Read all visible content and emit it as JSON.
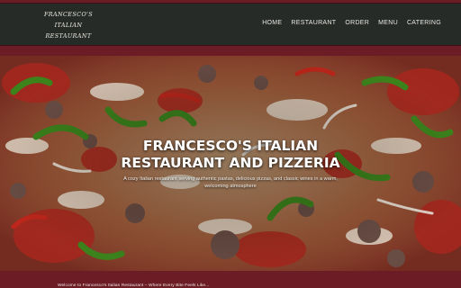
{
  "logo": {
    "line1": "FRANCESCO'S",
    "line2": "ITALIAN",
    "line3": "RESTAURANT"
  },
  "nav": {
    "items": [
      "HOME",
      "RESTAURANT",
      "ORDER",
      "MENU",
      "CATERING"
    ]
  },
  "hero": {
    "title_line1": "FRANCESCO'S ITALIAN",
    "title_line2": "RESTAURANT AND PIZZERIA",
    "subtitle": "A cozy Italian restaurant serving authentic pastas, delicious pizzas, and classic wines in a warm, welcoming atmosphere"
  },
  "footer": {
    "welcome_text": "Welcome to Francesco's Italian Restaurant – Where Every Bite Feels Like..."
  },
  "colors": {
    "page_background": "#6b1c24",
    "header_background": "#262b28",
    "text_light": "#ffffff"
  }
}
